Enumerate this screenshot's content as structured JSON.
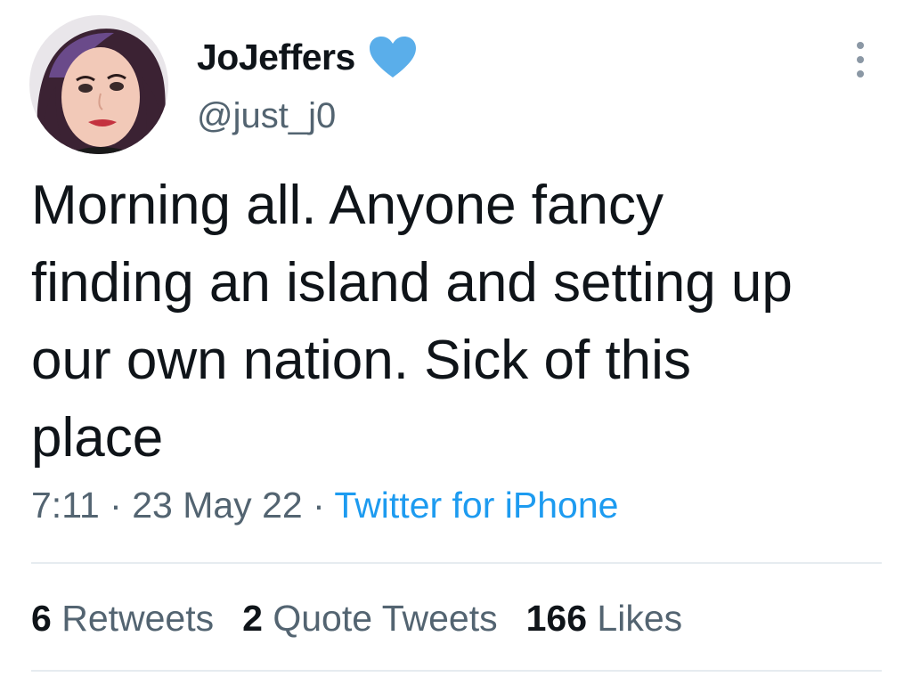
{
  "author": {
    "display_name": "JoJeffers",
    "handle": "@just_j0",
    "verified_icon": "blue-heart-icon",
    "badge_color": "#1d9bf0"
  },
  "menu": {
    "icon": "more-vertical-icon"
  },
  "tweet": {
    "text": "Morning all. Anyone fancy\nfinding an island and setting up\nour own nation. Sick of this\nplace",
    "time": "7:11",
    "separator": "·",
    "date": "23 May 22",
    "source": "Twitter for iPhone"
  },
  "stats": {
    "retweets_count": "6",
    "retweets_label": "Retweets",
    "quotes_count": "2",
    "quotes_label": "Quote Tweets",
    "likes_count": "166",
    "likes_label": "Likes"
  },
  "colors": {
    "text": "#0f1419",
    "secondary": "#536471",
    "link": "#1d9bf0",
    "divider": "#e6ecf0"
  }
}
